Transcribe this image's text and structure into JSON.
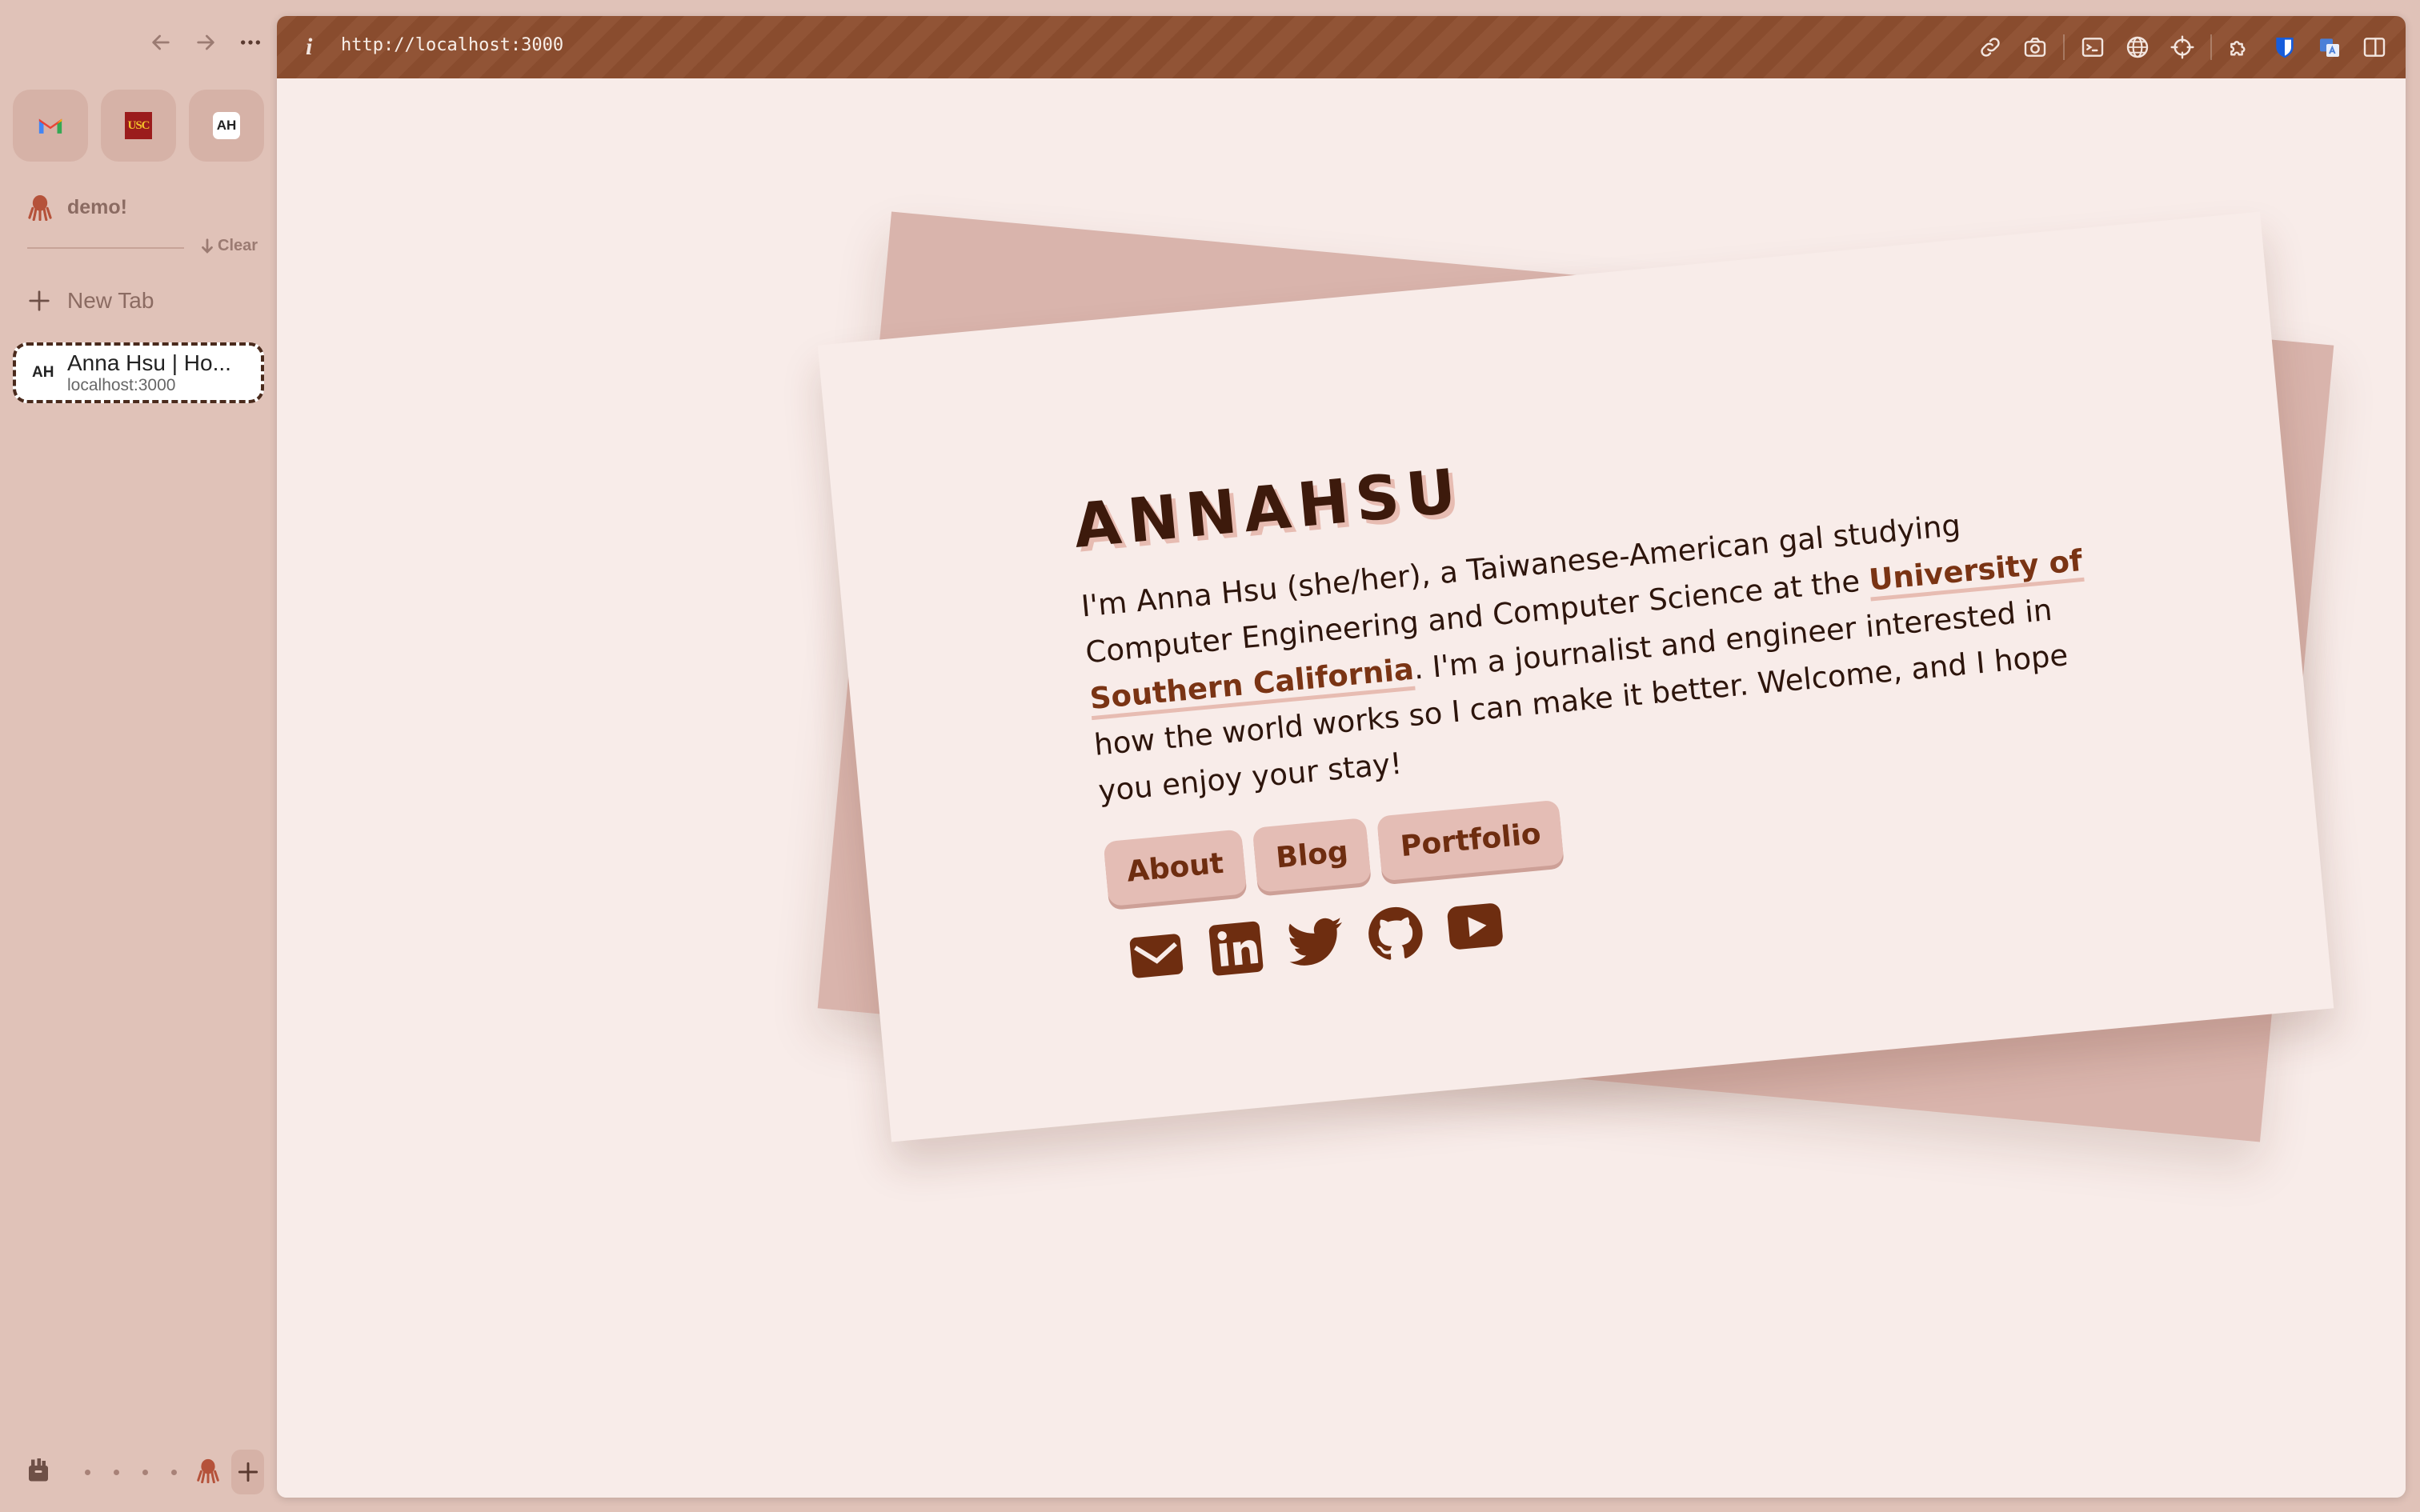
{
  "sidebar": {
    "pinned": [
      {
        "name": "Gmail",
        "icon": "gmail-icon"
      },
      {
        "name": "USC",
        "icon": "usc-icon",
        "label": "USC"
      },
      {
        "name": "Anna Hsu",
        "icon": "ah-icon",
        "label": "AH"
      }
    ],
    "space": {
      "name": "demo!",
      "icon": "octopus-icon"
    },
    "clear_label": "Clear",
    "new_tab_label": "New Tab",
    "tabs": [
      {
        "favicon": "AH",
        "title": "Anna Hsu | Ho...",
        "url": "localhost:3000"
      }
    ]
  },
  "toolbar": {
    "url": "http://localhost:3000",
    "info_icon": "i"
  },
  "page": {
    "name": "ANNAHSU",
    "bio_part1": "I'm Anna Hsu (she/her), a Taiwanese-American gal studying Computer Engineering and Computer Science at the ",
    "bio_link": "University of Southern California",
    "bio_part2": ". I'm a journalist and engineer interested in how the world works so I can make it better. Welcome, and I hope you enjoy your stay!",
    "buttons": [
      "About",
      "Blog",
      "Portfolio"
    ],
    "social": [
      "mail-icon",
      "linkedin-icon",
      "twitter-icon",
      "github-icon",
      "youtube-icon"
    ]
  },
  "colors": {
    "sidebar_bg": "#e0c2b8",
    "toolbar_bg": "#8d4e2f",
    "page_bg": "#f8ece9",
    "accent": "#7a3414",
    "heading": "#3d1a0c",
    "back_card": "#d9b4ac"
  }
}
